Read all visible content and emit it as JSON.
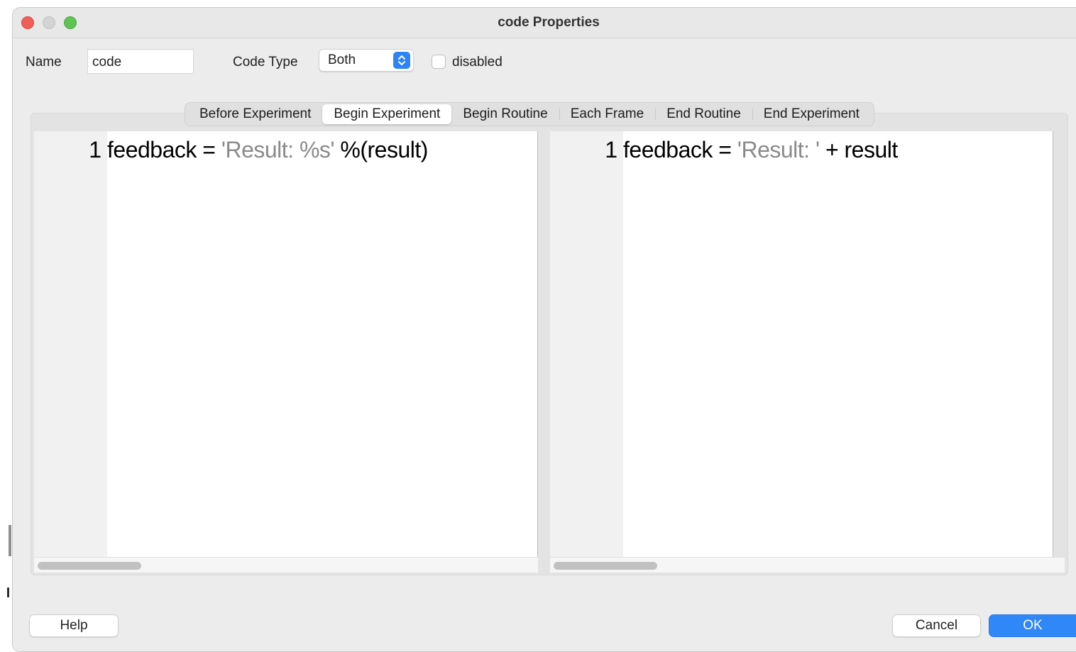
{
  "window": {
    "title": "code Properties"
  },
  "form": {
    "name_label": "Name",
    "name_value": "code",
    "code_type_label": "Code Type",
    "code_type_value": "Both",
    "disabled_label": "disabled",
    "disabled_checked": false
  },
  "tabs": [
    {
      "label": "Before Experiment",
      "active": false
    },
    {
      "label": "Begin Experiment",
      "active": true
    },
    {
      "label": "Begin Routine",
      "active": false
    },
    {
      "label": "Each Frame",
      "active": false
    },
    {
      "label": "End Routine",
      "active": false
    },
    {
      "label": "End Experiment",
      "active": false
    }
  ],
  "editors": {
    "python": {
      "line_number": "1",
      "code_pre": "feedback = ",
      "code_str": "'Result: %s'",
      "code_post": " %(result)"
    },
    "javascript": {
      "line_number": "1",
      "code_pre": "feedback = ",
      "code_str": "'Result: '",
      "code_post": " + result"
    }
  },
  "buttons": {
    "help": "Help",
    "cancel": "Cancel",
    "ok": "OK"
  },
  "colors": {
    "accent": "#2f87f8",
    "close": "#ee5f58",
    "zoom": "#5fc454",
    "string_literal": "#8a8a8a"
  }
}
